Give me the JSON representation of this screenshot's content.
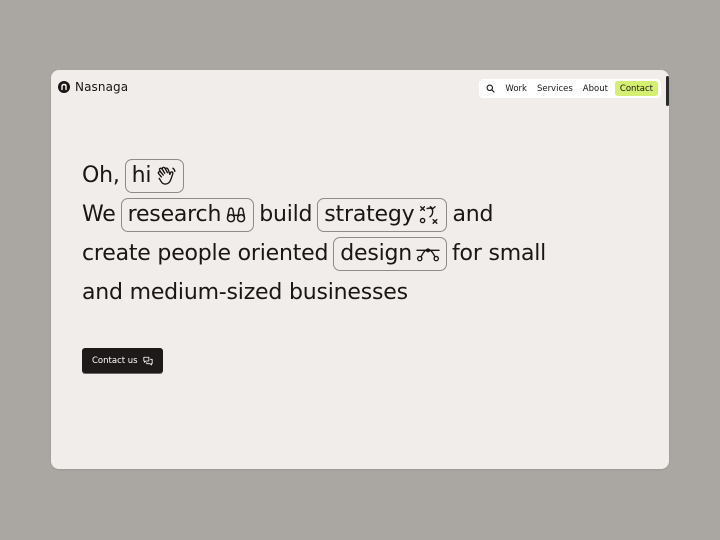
{
  "brand": {
    "name": "Nasnaga",
    "logo_icon": "nasnaga-logo-icon"
  },
  "nav": {
    "search_icon": "search-icon",
    "items": [
      "Work",
      "Services",
      "About"
    ],
    "contact_label": "Contact",
    "contact_color": "#d4ef72"
  },
  "hero": {
    "line1": {
      "prefix": "Oh,",
      "pill": "hi",
      "pill_icon": "waving-hand-icon"
    },
    "line2": {
      "prefix": "We",
      "pill1": "research",
      "pill1_icon": "binoculars-icon",
      "middle": "build",
      "pill2": "strategy",
      "pill2_icon": "strategy-play-icon",
      "suffix": "and"
    },
    "line3": {
      "prefix": "create people oriented",
      "pill": "design",
      "pill_icon": "bezier-curve-icon",
      "suffix": "for small"
    },
    "line4": "and medium-sized businesses"
  },
  "cta": {
    "label": "Contact us",
    "icon": "chat-bubbles-icon"
  },
  "colors": {
    "page_bg": "#aaa7a2",
    "window_bg": "#f0edea",
    "text": "#1a1616",
    "button_bg": "#1f1a1a"
  }
}
